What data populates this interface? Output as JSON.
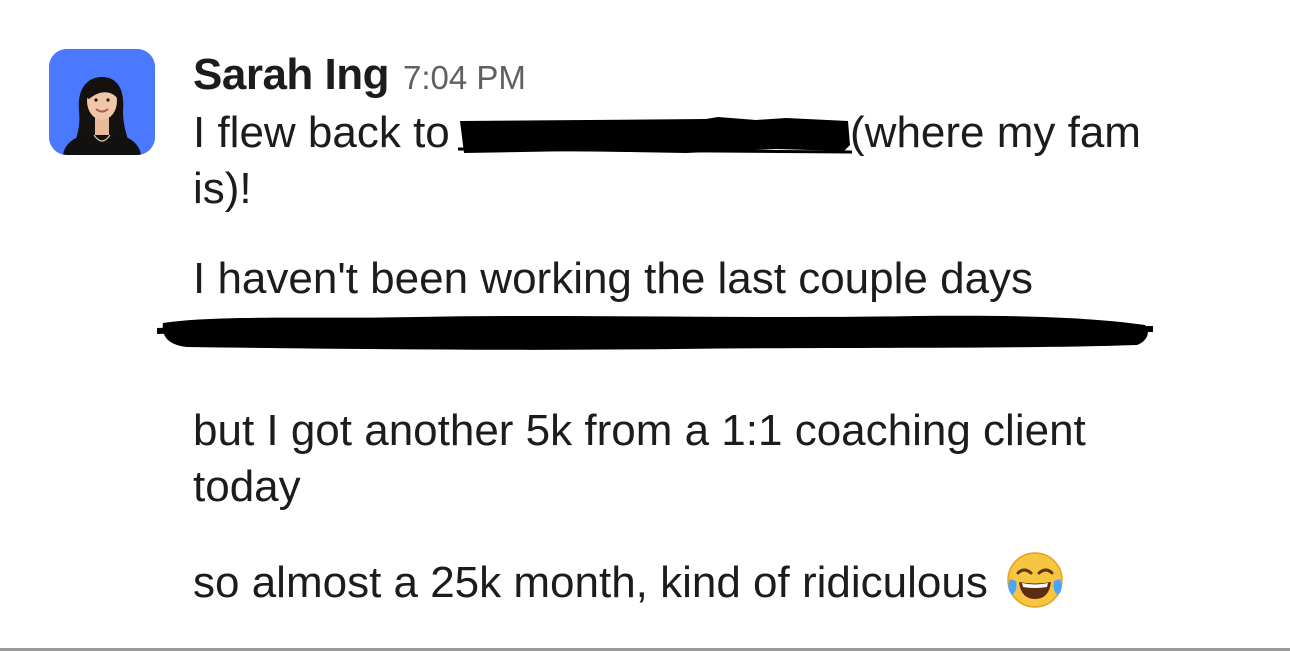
{
  "message": {
    "sender": "Sarah Ing",
    "timestamp": "7:04 PM",
    "avatar_icon": "profile-photo-woman",
    "avatar_bg": "#4a79ff",
    "paragraphs": {
      "p1_line1_before": "I flew back to ",
      "p1_line1_after": "(where my fam",
      "p1_line2": "is)!",
      "p2_line1": "I haven't been working the last couple days",
      "p3_line1": "but I got another 5k from a 1:1 coaching client",
      "p3_line2": "today",
      "p4_line1": "so almost a 25k month, kind of ridiculous"
    },
    "emoji_icon": "face-with-tears-of-joy-icon"
  }
}
